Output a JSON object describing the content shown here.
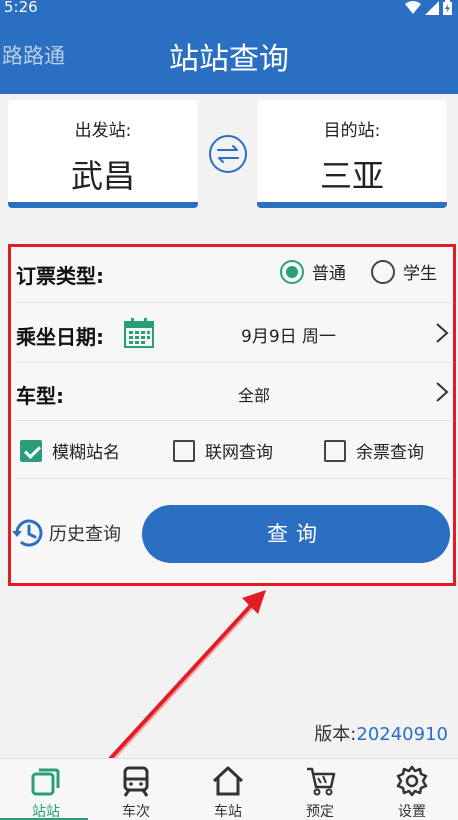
{
  "status": {
    "time": "5:26"
  },
  "app": {
    "brand": "路路通",
    "title": "站站查询"
  },
  "stations": {
    "from_label": "出发站:",
    "from_value": "武昌",
    "to_label": "目的站:",
    "to_value": "三亚"
  },
  "form": {
    "ticket_type_label": "订票类型:",
    "ticket_options": [
      {
        "label": "普通",
        "selected": true
      },
      {
        "label": "学生",
        "selected": false
      }
    ],
    "date_label": "乘坐日期:",
    "date_value": "9月9日 周一",
    "train_type_label": "车型:",
    "train_type_value": "全部",
    "checks": [
      {
        "label": "模糊站名",
        "checked": true
      },
      {
        "label": "联网查询",
        "checked": false
      },
      {
        "label": "余票查询",
        "checked": false
      }
    ],
    "history_label": "历史查询",
    "query_label": "查询"
  },
  "version": {
    "label": "版本:",
    "number": "20240910"
  },
  "nav": [
    {
      "label": "站站",
      "icon": "station-to-station-icon",
      "active": true
    },
    {
      "label": "车次",
      "icon": "train-icon",
      "active": false
    },
    {
      "label": "车站",
      "icon": "home-station-icon",
      "active": false
    },
    {
      "label": "预定",
      "icon": "cart-icon",
      "active": false
    },
    {
      "label": "设置",
      "icon": "gear-icon",
      "active": false
    }
  ],
  "colors": {
    "primary": "#2b6fc2",
    "accent": "#2a9e7a",
    "highlight": "#e11c24"
  }
}
